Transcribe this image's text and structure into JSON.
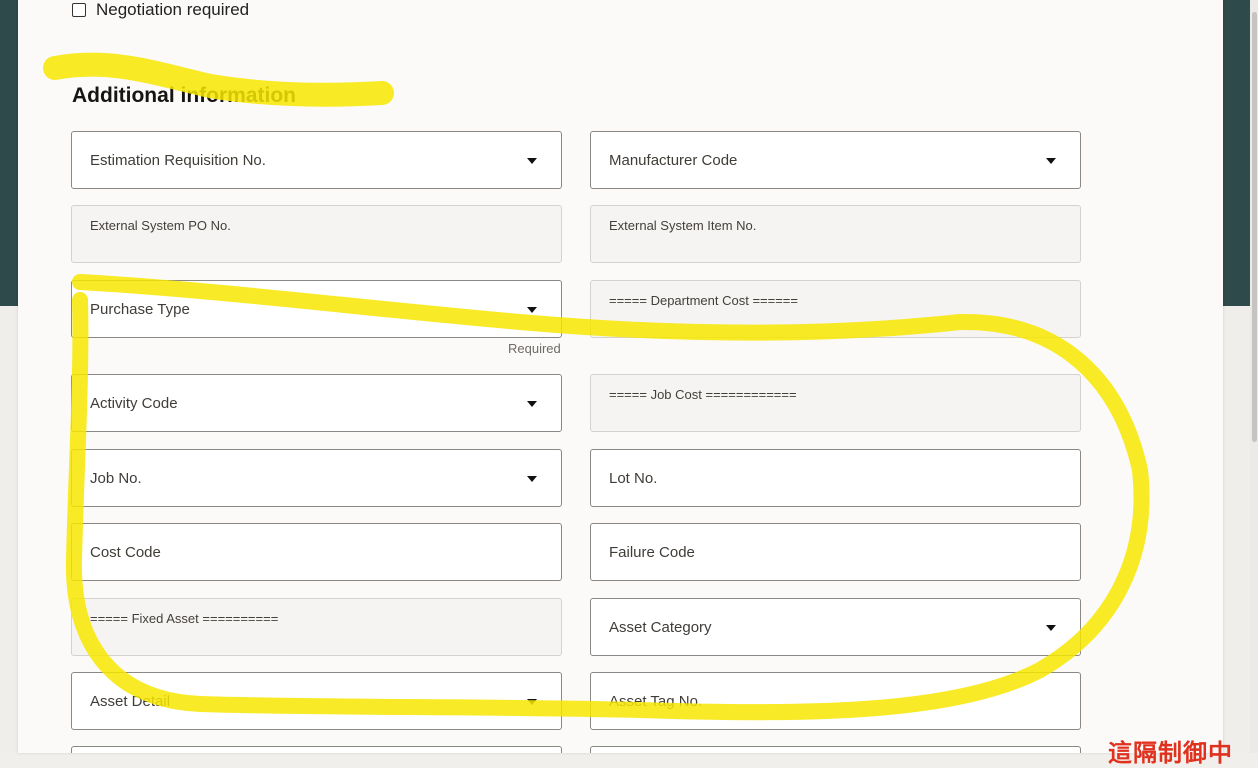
{
  "negotiation": {
    "label": "Negotiation required",
    "checked": false
  },
  "section": {
    "title": "Additional information"
  },
  "fields": {
    "estimation_requisition": "Estimation Requisition No.",
    "manufacturer_code": "Manufacturer Code",
    "external_po": "External System PO No.",
    "external_item": "External System Item No.",
    "purchase_type": "Purchase Type",
    "purchase_type_helper": "Required",
    "department_cost": "===== Department Cost ======",
    "activity_code": "Activity Code",
    "job_cost": "===== Job Cost ============",
    "job_no": "Job No.",
    "lot_no": "Lot No.",
    "cost_code": "Cost Code",
    "failure_code": "Failure Code",
    "fixed_asset": "===== Fixed Asset ==========",
    "asset_category": "Asset Category",
    "asset_detail": "Asset Detail",
    "asset_tag": "Asset Tag No."
  },
  "overlay": {
    "stamp_text": "這隔制御中",
    "highlight_color": "#f7e600"
  },
  "icons": {
    "dropdown": "chevron-down-icon",
    "checkbox": "checkbox-icon"
  }
}
